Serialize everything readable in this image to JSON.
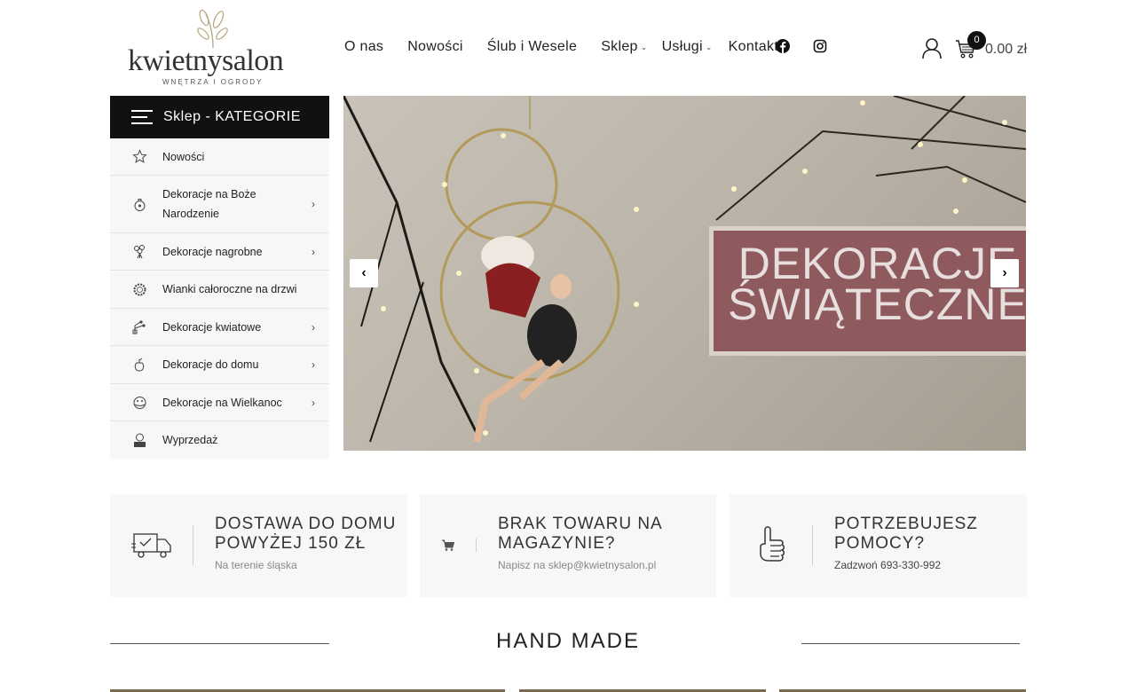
{
  "header": {
    "logo_text": "kwietnysalon",
    "logo_sub": "WNĘTRZA I OGRODY",
    "nav": [
      {
        "label": "O nas"
      },
      {
        "label": "Nowości"
      },
      {
        "label": "Ślub i Wesele"
      },
      {
        "label": "Sklep",
        "dropdown": true
      },
      {
        "label": "Usługi",
        "dropdown": true
      },
      {
        "label": "Kontakt"
      }
    ],
    "social_icons": [
      "facebook-icon",
      "instagram-icon"
    ],
    "cart_count": "0",
    "cart_total": "0.00 zł"
  },
  "sidebar": {
    "title": "Sklep - KATEGORIE",
    "items": [
      {
        "label": "Nowości",
        "icon": "star-icon",
        "has_arrow": false
      },
      {
        "label": "Dekoracje na Boże Narodzenie",
        "icon": "ornament-icon",
        "has_arrow": true
      },
      {
        "label": "Dekoracje nagrobne",
        "icon": "bouquet-icon",
        "has_arrow": true
      },
      {
        "label": "Wianki całoroczne na drzwi",
        "icon": "wreath-icon",
        "has_arrow": false
      },
      {
        "label": "Dekoracje kwiatowe",
        "icon": "flower-icon",
        "has_arrow": true
      },
      {
        "label": "Dekoracje do domu",
        "icon": "vase-icon",
        "has_arrow": true
      },
      {
        "label": "Dekoracje na Wielkanoc",
        "icon": "egg-icon",
        "has_arrow": true
      },
      {
        "label": "Wyprzedaż",
        "icon": "handmade-icon",
        "has_arrow": false
      }
    ]
  },
  "slider": {
    "text_line1": "DEKORACJE",
    "text_line2": "ŚWIĄTECZNE",
    "prev_icon": "chevron-left-icon",
    "next_icon": "chevron-right-icon"
  },
  "info_boxes": [
    {
      "icon": "delivery-truck-icon",
      "title_line1": "DOSTAWA DO DOMU",
      "title_line2": "POWYŻEJ 150 ZŁ",
      "subtitle": "Na terenie śląska"
    },
    {
      "icon": "cart-icon",
      "title_line1": "BRAK TOWARU NA",
      "title_line2": "MAGAZYNIE?",
      "subtitle": "Napisz na sklep@kwietnysalon.pl"
    },
    {
      "icon": "thumbs-up-icon",
      "title_line1": "POTRZEBUJESZ",
      "title_line2": "POMOCY?",
      "subtitle": "Zadzwoń 693-330-992"
    }
  ],
  "section": {
    "title": "HAND MADE"
  },
  "colors": {
    "primary": "#111111",
    "panel_bg": "#f7f7f7",
    "banner": "#8f5a5e"
  }
}
